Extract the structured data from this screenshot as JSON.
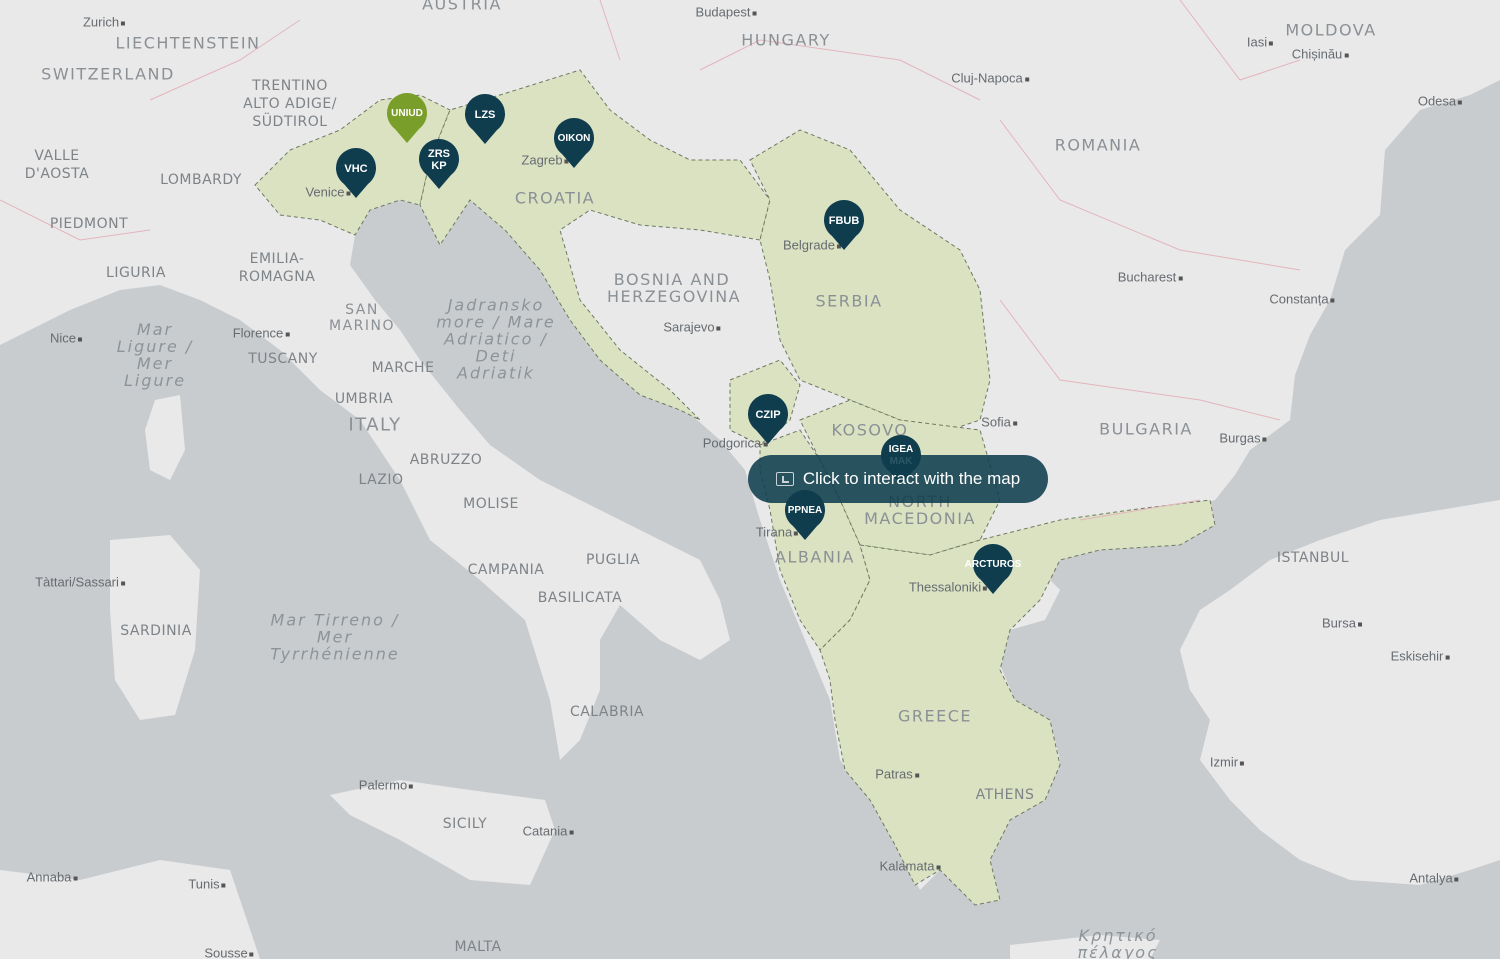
{
  "overlay": {
    "label": "Click to interact with the map",
    "icon": "map-icon"
  },
  "colors": {
    "land": "#e9e9e9",
    "water": "#c9ccce",
    "highlight": "#dbe2c2",
    "pin": "#0f3d4e",
    "pin_active": "#7a9e2a"
  },
  "markers": [
    {
      "label": "UNIUD",
      "active": true
    },
    {
      "label": "LZS",
      "active": false
    },
    {
      "label": "OIKON",
      "active": false
    },
    {
      "label": "ZRS KP",
      "active": false
    },
    {
      "label": "VHC",
      "active": false
    },
    {
      "label": "FBUB",
      "active": false
    },
    {
      "label": "CZIP",
      "active": false
    },
    {
      "label": "IGEA MAK",
      "active": false
    },
    {
      "label": "PPNEA",
      "active": false
    },
    {
      "label": "ARCTUROS",
      "active": false
    }
  ],
  "countries": [
    "AUSTRIA",
    "HUNGARY",
    "MOLDOVA",
    "LIECHTENSTEIN",
    "SWITZERLAND",
    "ROMANIA",
    "CROATIA",
    "BOSNIA AND HERZEGOVINA",
    "SERBIA",
    "BULGARIA",
    "KOSOVO",
    "NORTH MACEDONIA",
    "ALBANIA",
    "GREECE",
    "ITALY",
    "SAN MARINO"
  ],
  "regions": [
    "TRENTINO ALTO ADIGE/ SÜDTIROL",
    "VALLE D'AOSTA",
    "LOMBARDY",
    "PIEDMONT",
    "LIGURIA",
    "EMILIA- ROMAGNA",
    "TUSCANY",
    "MARCHE",
    "UMBRIA",
    "ABRUZZO",
    "LAZIO",
    "MOLISE",
    "PUGLIA",
    "CAMPANIA",
    "BASILICATA",
    "SARDINIA",
    "CALABRIA",
    "SICILY",
    "ISTANBUL",
    "ATHENS"
  ],
  "cities": [
    "Zurich",
    "Budapest",
    "Iasi",
    "Chișinău",
    "Cluj-Napoca",
    "Odesa",
    "Bucharest",
    "Constanța",
    "Belgrade",
    "Sarajevo",
    "Sofia",
    "Burgas",
    "Florence",
    "Nice",
    "Podgorica",
    "Tirana",
    "Thessaloniki",
    "Bursa",
    "Eskisehir",
    "Izmir",
    "Patras",
    "Kalamata",
    "Antalya",
    "Palermo",
    "Catania",
    "Tunis",
    "Annaba",
    "Sousse",
    "Tàttari/Sassari",
    "Venice",
    "Zagreb",
    "MALTA"
  ],
  "seas": [
    "Mar Ligure / Mer Ligure",
    "Jadransko more / Mare Adriatico / Deti Adriatik",
    "Mar Tirreno / Mer Tyrrhénienne",
    "Κρητικό πέλαγος"
  ]
}
